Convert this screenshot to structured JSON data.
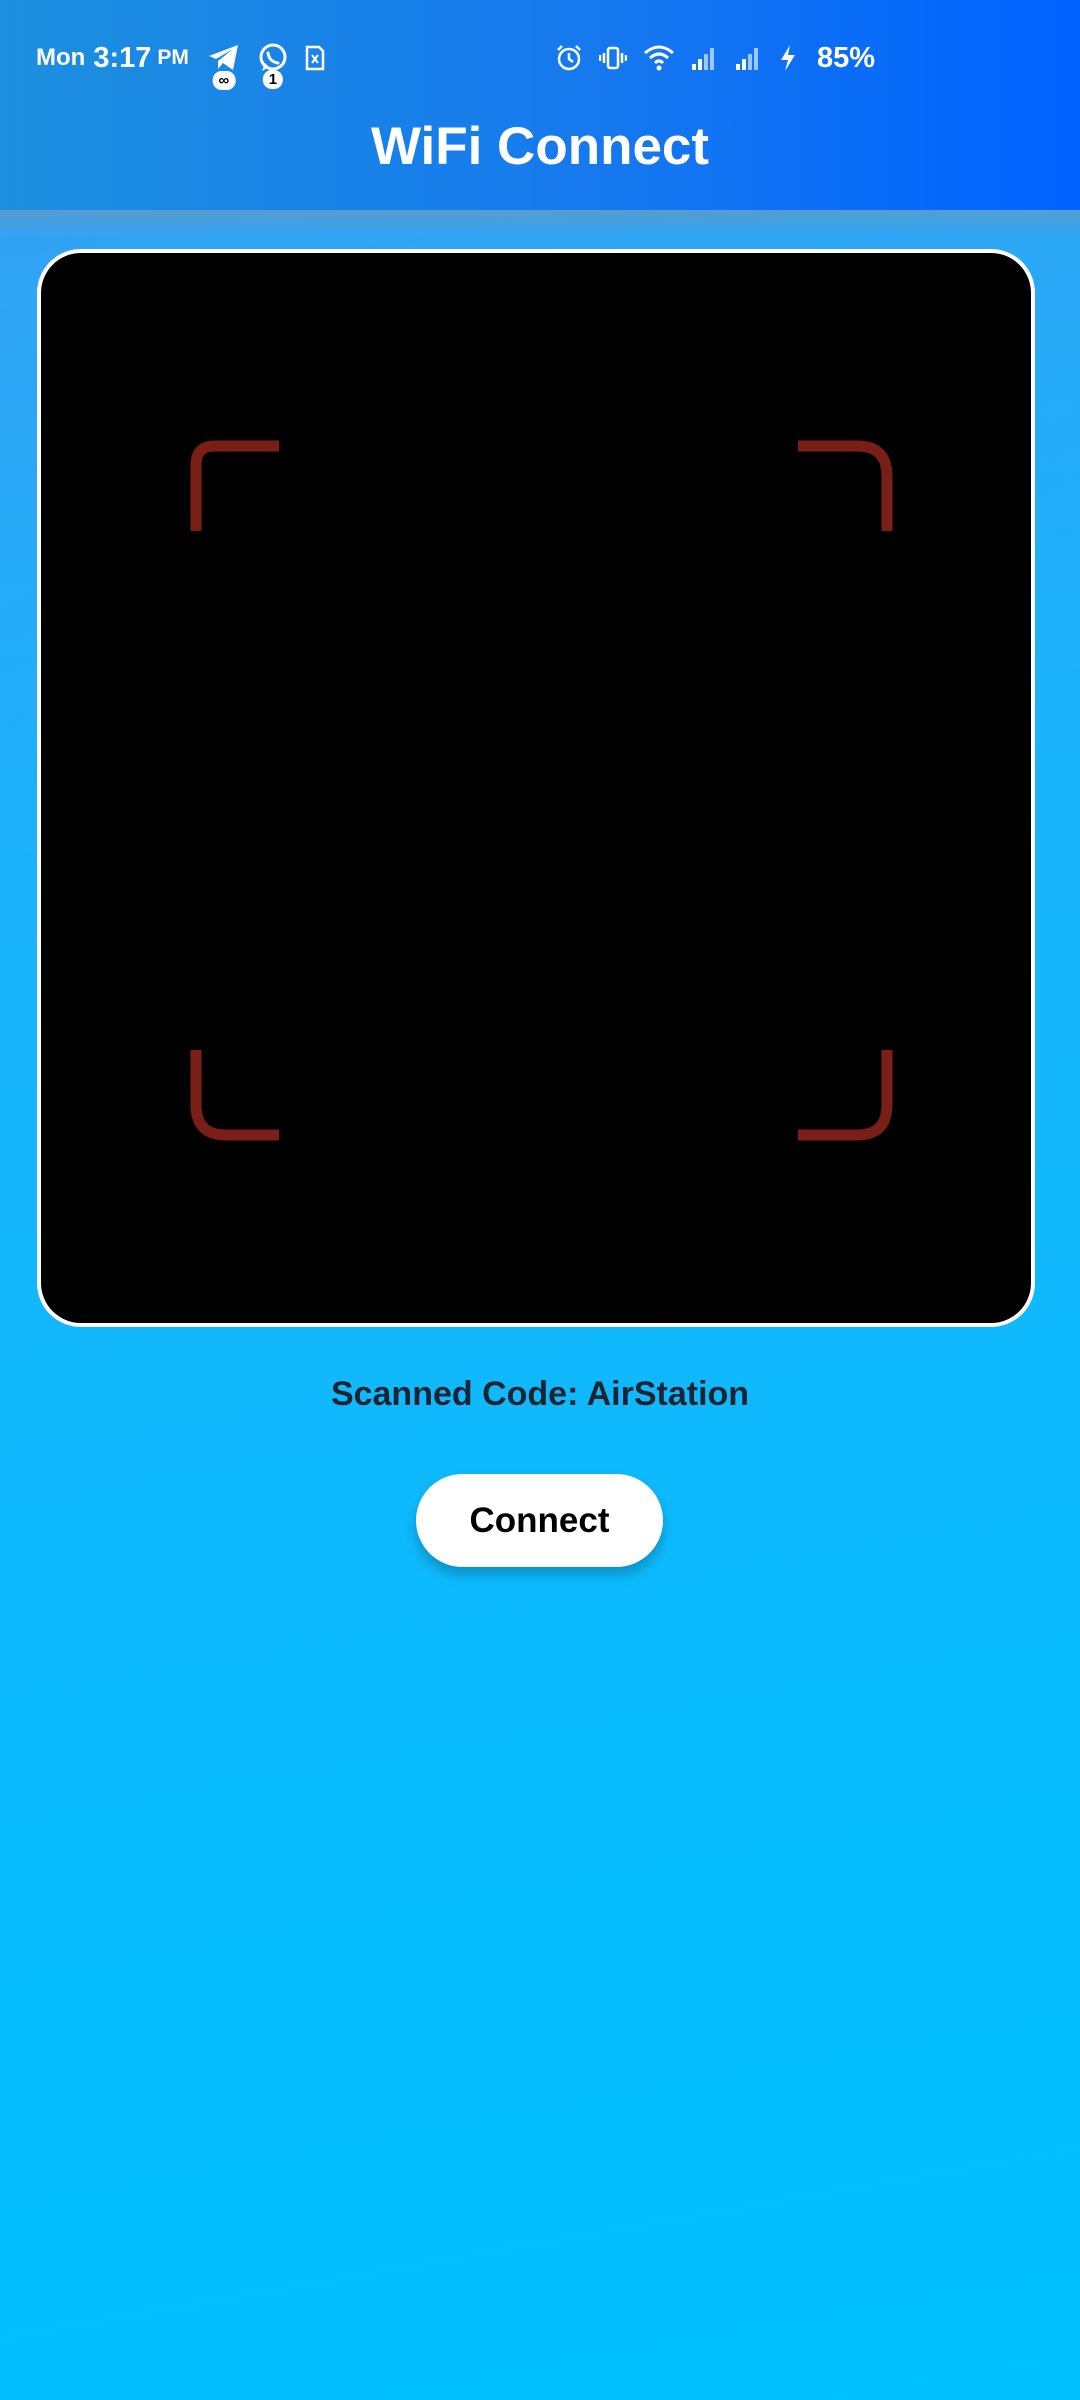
{
  "status_bar": {
    "day": "Mon",
    "time": "3:17",
    "ampm": "PM",
    "telegram_badge": "∞",
    "whatsapp_badge": "1",
    "battery": "85%",
    "icons": [
      "telegram-icon",
      "whatsapp-icon",
      "sim-card-icon",
      "alarm-icon",
      "vibrate-icon",
      "wifi-icon",
      "signal-icon",
      "signal-icon",
      "charging-icon"
    ]
  },
  "app_bar": {
    "title": "WiFi Connect"
  },
  "scanner": {
    "frame_color": "#7a1f17",
    "background": "#000000"
  },
  "result": {
    "text": "Scanned Code: AirStation"
  },
  "actions": {
    "connect_label": "Connect"
  },
  "colors": {
    "app_bar_start": "#1d8fdf",
    "app_bar_end": "#0062ff",
    "page_bg_top": "#3a9df2",
    "page_bg_bottom": "#00c1ff"
  }
}
